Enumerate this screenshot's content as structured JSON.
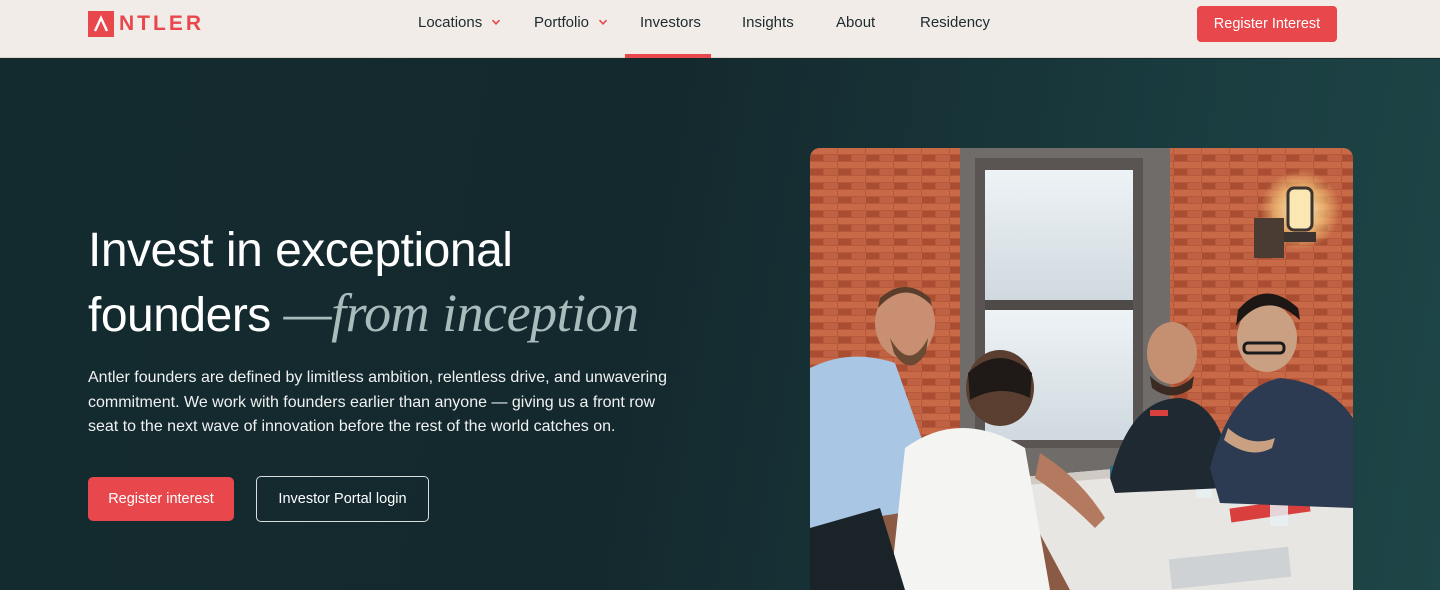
{
  "brand": {
    "name": "NTLER",
    "mark": "A",
    "color": "#e8474c"
  },
  "nav": {
    "items": [
      {
        "label": "Locations",
        "has_dropdown": true
      },
      {
        "label": "Portfolio",
        "has_dropdown": true
      },
      {
        "label": "Investors",
        "active": true
      },
      {
        "label": "Insights"
      },
      {
        "label": "About"
      },
      {
        "label": "Residency"
      }
    ],
    "cta_label": "Register Interest"
  },
  "hero": {
    "headline_line1": "Invest in exceptional",
    "headline_line2": "founders",
    "headline_accent": "—from inception",
    "lead": "Antler founders are defined by limitless ambition, relentless drive, and unwavering commitment. We work with founders earlier than anyone — giving us a front row seat to the next wave of innovation before the rest of the world catches on.",
    "primary_button": "Register interest",
    "secondary_button": "Investor Portal login"
  },
  "colors": {
    "accent": "#e8474c",
    "hero_bg": "#14292e",
    "nav_bg": "#f1ece8"
  }
}
